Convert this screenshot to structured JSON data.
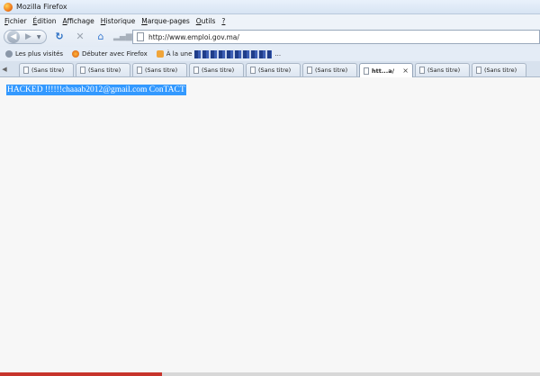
{
  "window": {
    "title": "Mozilla Firefox"
  },
  "menu": [
    {
      "u": "F",
      "rest": "ichier"
    },
    {
      "u": "É",
      "rest": "dition"
    },
    {
      "u": "A",
      "rest": "ffichage"
    },
    {
      "u": "H",
      "rest": "istorique"
    },
    {
      "u": "M",
      "rest": "arque-pages"
    },
    {
      "u": "O",
      "rest": "utils"
    },
    {
      "u": "?",
      "rest": ""
    }
  ],
  "address": {
    "url": "http://www.emploi.gov.ma/"
  },
  "bookmarks": {
    "most_visited": "Les plus visités",
    "getting_started": "Débuter avec Firefox",
    "headlines": "À la une",
    "trailing": "..."
  },
  "tabs": [
    {
      "label": "(Sans titre)"
    },
    {
      "label": "(Sans titre)"
    },
    {
      "label": "(Sans titre)"
    },
    {
      "label": "(Sans titre)"
    },
    {
      "label": "(Sans titre)"
    },
    {
      "label": "(Sans titre)"
    },
    {
      "label": "htt...a/",
      "active": true
    },
    {
      "label": "(Sans titre)"
    },
    {
      "label": "(Sans titre)"
    }
  ],
  "tab_close": "×",
  "page": {
    "text": "HACKED !!!!!!chaaab2012@gmail.com ConTACT"
  }
}
